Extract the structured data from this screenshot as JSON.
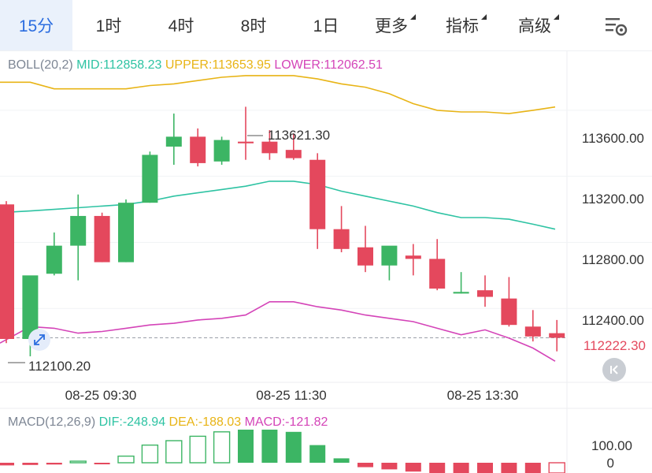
{
  "tabs": [
    {
      "label": "15分",
      "active": true
    },
    {
      "label": "1时"
    },
    {
      "label": "4时"
    },
    {
      "label": "8时"
    },
    {
      "label": "1日"
    },
    {
      "label": "更多",
      "dropdown": true
    },
    {
      "label": "指标",
      "dropdown": true
    },
    {
      "label": "高级",
      "dropdown": true
    }
  ],
  "settings_icon": "chart-settings-icon",
  "boll": {
    "name": "BOLL(20,2)",
    "mid": "MID:112858.23",
    "upper": "UPPER:113653.95",
    "lower": "LOWER:112062.51"
  },
  "macd": {
    "name": "MACD(12,26,9)",
    "dif": "DIF:-248.94",
    "dea": "DEA:-188.03",
    "macd": "MACD:-121.82"
  },
  "colors": {
    "up": "#3cb564",
    "down": "#e4485d",
    "mid": "#2ec3a3",
    "upper": "#e8b416",
    "lower": "#d444b8",
    "accent": "#2b6de0"
  },
  "price_axis": [
    "113600.00",
    "113200.00",
    "112800.00",
    "112400.00"
  ],
  "current_price": "112222.30",
  "time_axis": [
    "08-25 09:30",
    "08-25 11:30",
    "08-25 13:30"
  ],
  "high_annotation": "113621.30",
  "low_annotation": "112100.20",
  "macd_axis": [
    "100.00",
    "0"
  ],
  "chart_data": {
    "type": "candlestick",
    "y_range": [
      112000,
      113800
    ],
    "candles": [
      {
        "o": 113030,
        "h": 113050,
        "l": 112190,
        "c": 112215
      },
      {
        "o": 112215,
        "h": 112230,
        "l": 112110,
        "c": 112600
      },
      {
        "o": 112610,
        "h": 112860,
        "l": 112600,
        "c": 112780
      },
      {
        "o": 112780,
        "h": 113090,
        "l": 112570,
        "c": 112960
      },
      {
        "o": 112960,
        "h": 112980,
        "l": 112680,
        "c": 112680
      },
      {
        "o": 112680,
        "h": 113060,
        "l": 112680,
        "c": 113040
      },
      {
        "o": 113040,
        "h": 113350,
        "l": 113040,
        "c": 113330
      },
      {
        "o": 113380,
        "h": 113580,
        "l": 113270,
        "c": 113440
      },
      {
        "o": 113440,
        "h": 113490,
        "l": 113260,
        "c": 113280
      },
      {
        "o": 113290,
        "h": 113440,
        "l": 113270,
        "c": 113420
      },
      {
        "o": 113410,
        "h": 113621.3,
        "l": 113300,
        "c": 113400
      },
      {
        "o": 113410,
        "h": 113480,
        "l": 113300,
        "c": 113340
      },
      {
        "o": 113360,
        "h": 113460,
        "l": 113300,
        "c": 113310
      },
      {
        "o": 113300,
        "h": 113340,
        "l": 112760,
        "c": 112880
      },
      {
        "o": 112880,
        "h": 113020,
        "l": 112740,
        "c": 112760
      },
      {
        "o": 112770,
        "h": 112900,
        "l": 112620,
        "c": 112660
      },
      {
        "o": 112660,
        "h": 112760,
        "l": 112570,
        "c": 112780
      },
      {
        "o": 112720,
        "h": 112790,
        "l": 112600,
        "c": 112700
      },
      {
        "o": 112700,
        "h": 112820,
        "l": 112510,
        "c": 112520
      },
      {
        "o": 112490,
        "h": 112620,
        "l": 112490,
        "c": 112500
      },
      {
        "o": 112510,
        "h": 112600,
        "l": 112410,
        "c": 112470
      },
      {
        "o": 112460,
        "h": 112590,
        "l": 112290,
        "c": 112300
      },
      {
        "o": 112290,
        "h": 112390,
        "l": 112200,
        "c": 112230
      },
      {
        "o": 112250,
        "h": 112330,
        "l": 112140,
        "c": 112222.3
      }
    ],
    "boll_upper": [
      113770,
      113770,
      113730,
      113730,
      113730,
      113730,
      113750,
      113760,
      113780,
      113800,
      113810,
      113810,
      113810,
      113790,
      113760,
      113740,
      113700,
      113640,
      113600,
      113590,
      113590,
      113580,
      113600,
      113620
    ],
    "boll_mid": [
      112980,
      112990,
      113000,
      113010,
      113020,
      113030,
      113050,
      113080,
      113100,
      113120,
      113140,
      113170,
      113170,
      113150,
      113110,
      113080,
      113050,
      113020,
      112980,
      112950,
      112950,
      112940,
      112910,
      112880
    ],
    "boll_lower": [
      112190,
      112290,
      112280,
      112250,
      112260,
      112280,
      112300,
      112310,
      112330,
      112340,
      112360,
      112440,
      112440,
      112410,
      112390,
      112360,
      112340,
      112320,
      112280,
      112240,
      112270,
      112220,
      112160,
      112080
    ],
    "macd_hist": [
      -12,
      -10,
      -8,
      6,
      -6,
      30,
      80,
      100,
      120,
      140,
      150,
      150,
      140,
      80,
      20,
      -20,
      -30,
      -40,
      -55,
      -70,
      -85,
      -100,
      -115,
      -121.82
    ],
    "macd_y_range": [
      -130,
      150
    ]
  }
}
